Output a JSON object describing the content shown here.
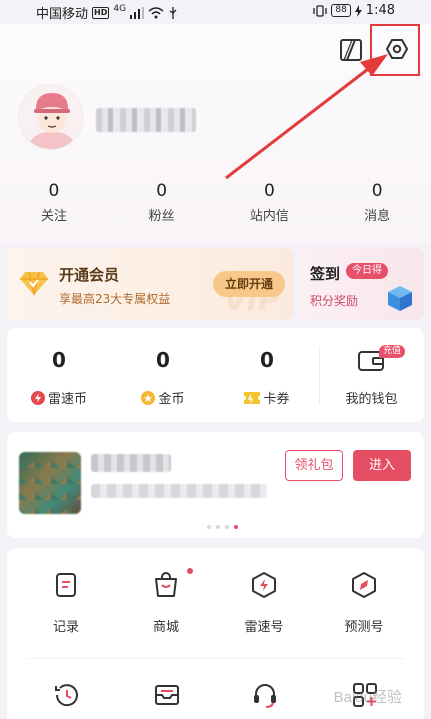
{
  "status_bar": {
    "carrier": "中国移动",
    "hd": "HD",
    "signal": "4G",
    "battery": "88",
    "time": "1:48"
  },
  "profile": {
    "username_blurred": true
  },
  "stats": [
    {
      "value": "0",
      "label": "关注"
    },
    {
      "value": "0",
      "label": "粉丝"
    },
    {
      "value": "0",
      "label": "站内信"
    },
    {
      "value": "0",
      "label": "消息"
    }
  ],
  "vip": {
    "title": "开通会员",
    "subtitle": "享最高23大专属权益",
    "button": "立即开通",
    "watermark": "VIP"
  },
  "checkin": {
    "title": "签到",
    "tag": "今日得",
    "subtitle": "积分奖励"
  },
  "wallet": {
    "items": [
      {
        "value": "0",
        "label": "雷速币",
        "icon": "lightning-coin-icon"
      },
      {
        "value": "0",
        "label": "金币",
        "icon": "gold-coin-icon"
      },
      {
        "value": "0",
        "label": "卡券",
        "icon": "ticket-icon"
      }
    ],
    "wallet_label": "我的钱包",
    "recharge_tag": "充值"
  },
  "game": {
    "gift_button": "领礼包",
    "enter_button": "进入"
  },
  "tools": [
    {
      "label": "记录",
      "icon": "record-icon"
    },
    {
      "label": "商城",
      "icon": "mall-icon"
    },
    {
      "label": "雷速号",
      "icon": "leisu-number-icon"
    },
    {
      "label": "预测号",
      "icon": "prediction-icon"
    }
  ],
  "watermark": "Baidu经验",
  "colors": {
    "accent": "#e54d63",
    "annotation": "#e53a3a",
    "vip_button": "#f6c98a"
  }
}
